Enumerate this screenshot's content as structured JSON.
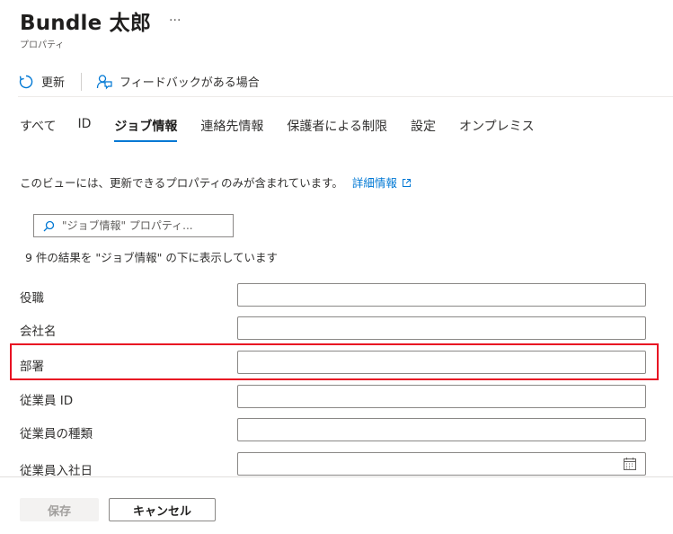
{
  "header": {
    "title": "Bundle 太郎",
    "more_label": "···",
    "subtitle": "プロパティ"
  },
  "toolbar": {
    "refresh_label": "更新",
    "feedback_label": "フィードバックがある場合"
  },
  "tabs": [
    {
      "label": "すべて",
      "active": false
    },
    {
      "label": "ID",
      "active": false
    },
    {
      "label": "ジョブ情報",
      "active": true
    },
    {
      "label": "連絡先情報",
      "active": false
    },
    {
      "label": "保護者による制限",
      "active": false
    },
    {
      "label": "設定",
      "active": false
    },
    {
      "label": "オンプレミス",
      "active": false
    }
  ],
  "info": {
    "text": "このビューには、更新できるプロパティのみが含まれています。",
    "link_label": "詳細情報"
  },
  "search": {
    "placeholder": "\"ジョブ情報\" プロパティ..."
  },
  "results_text": "9 件の結果を \"ジョブ情報\" の下に表示しています",
  "fields": [
    {
      "label": "役職",
      "value": ""
    },
    {
      "label": "会社名",
      "value": ""
    },
    {
      "label": "部署",
      "value": "",
      "highlighted": true
    },
    {
      "label": "従業員 ID",
      "value": ""
    },
    {
      "label": "従業員の種類",
      "value": ""
    },
    {
      "label": "従業員入社日",
      "value": "",
      "type": "date"
    }
  ],
  "footer": {
    "save_label": "保存",
    "cancel_label": "キャンセル"
  },
  "colors": {
    "accent": "#0078d4",
    "highlight": "#e81123",
    "disabled_bg": "#f3f2f1"
  }
}
